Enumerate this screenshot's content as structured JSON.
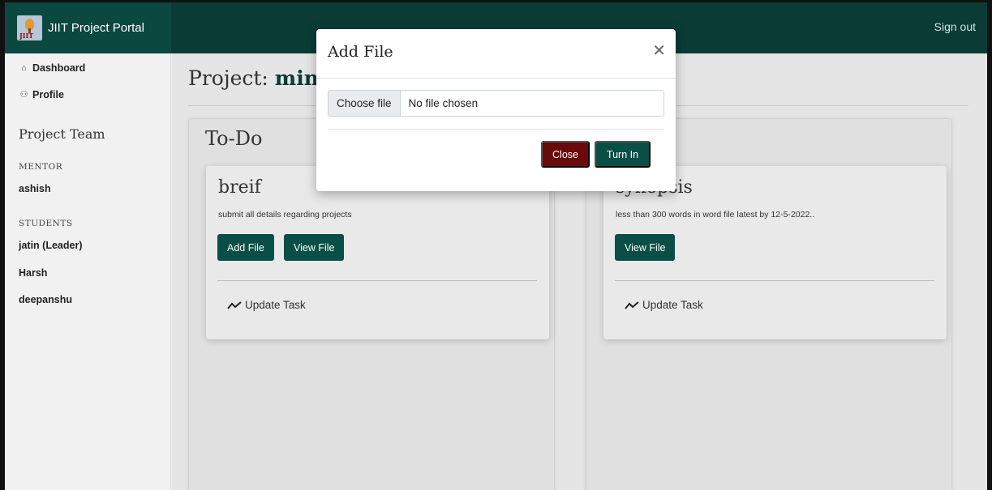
{
  "navbar": {
    "brand_logo_text": "JIIT",
    "brand_name": "JIIT Project Portal",
    "signout_label": "Sign out"
  },
  "sidebar": {
    "links": [
      {
        "label": "Dashboard",
        "icon": "home-icon"
      },
      {
        "label": "Profile",
        "icon": "users-icon"
      }
    ],
    "team_heading": "Project Team",
    "mentor_label": "MENTOR",
    "mentor_name": "ashish",
    "students_label": "STUDENTS",
    "students": [
      "jatin (Leader)",
      "Harsh",
      "deepanshu"
    ]
  },
  "main": {
    "project_prefix": "Project: ",
    "project_name": "min",
    "columns": [
      {
        "title": "To-Do",
        "card": {
          "title": "breif",
          "description": "submit all details regarding projects",
          "add_file_label": "Add File",
          "view_file_label": "View File",
          "update_label": "Update Task"
        }
      },
      {
        "title": "",
        "card": {
          "title": "synopsis",
          "description": "less than 300 words in word file latest by 12-5-2022..",
          "view_file_label": "View File",
          "update_label": "Update Task"
        }
      }
    ]
  },
  "modal": {
    "title": "Add File",
    "close_icon": "close-icon",
    "choose_file_label": "Choose file",
    "file_name": "No file chosen",
    "close_label": "Close",
    "turn_in_label": "Turn In"
  },
  "colors": {
    "navbar": "#0a3c35",
    "primary_button": "#0a4f46",
    "close_button": "#6b0a0a"
  }
}
